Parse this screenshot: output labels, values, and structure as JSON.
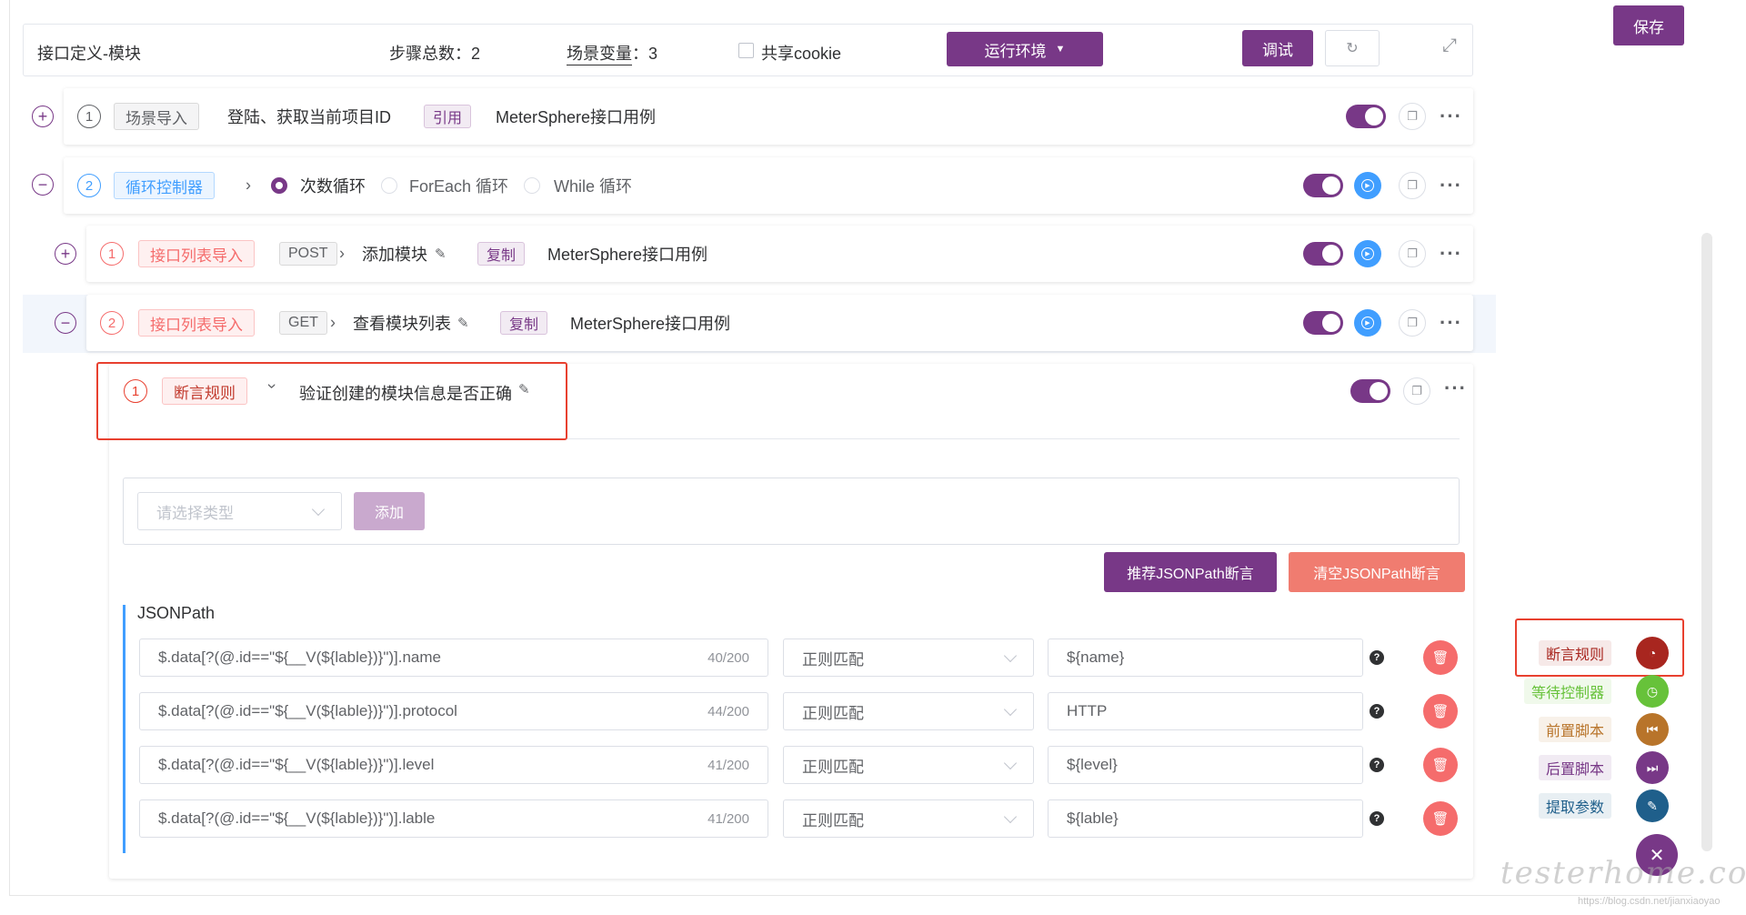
{
  "header": {
    "title": "接口定义-模块",
    "steps_total_label": "步骤总数：2",
    "scene_var_label": "场景变量",
    "scene_var_value": "：3",
    "share_cookie_label": "共享cookie",
    "env_button": "运行环境",
    "debug_button": "调试",
    "save_button": "保存"
  },
  "steps": [
    {
      "num": "1",
      "tag": "场景导入",
      "name": "登陆、获取当前项目ID",
      "ref_tag": "引用",
      "project": "MeterSphere接口用例"
    },
    {
      "num": "2",
      "tag": "循环控制器",
      "loop_options": [
        "次数循环",
        "ForEach 循环",
        "While 循环"
      ]
    },
    {
      "num": "1",
      "tag": "接口列表导入",
      "method": "POST",
      "name": "添加模块",
      "ref_tag": "复制",
      "project": "MeterSphere接口用例"
    },
    {
      "num": "2",
      "tag": "接口列表导入",
      "method": "GET",
      "name": "查看模块列表",
      "ref_tag": "复制",
      "project": "MeterSphere接口用例"
    }
  ],
  "assertion": {
    "num": "1",
    "tag": "断言规则",
    "name": "验证创建的模块信息是否正确",
    "type_placeholder": "请选择类型",
    "add_button": "添加",
    "recommend_button": "推荐JSONPath断言",
    "clear_button": "清空JSONPath断言",
    "section_title": "JSONPath",
    "rows": [
      {
        "expression": "$.data[?(@.id==\"${__V(${lable})}\")].name",
        "count": "40/200",
        "match": "正则匹配",
        "expected": "${name}"
      },
      {
        "expression": "$.data[?(@.id==\"${__V(${lable})}\")].protocol",
        "count": "44/200",
        "match": "正则匹配",
        "expected": "HTTP"
      },
      {
        "expression": "$.data[?(@.id==\"${__V(${lable})}\")].level",
        "count": "41/200",
        "match": "正则匹配",
        "expected": "${level}"
      },
      {
        "expression": "$.data[?(@.id==\"${__V(${lable})}\")].lable",
        "count": "41/200",
        "match": "正则匹配",
        "expected": "${lable}"
      }
    ]
  },
  "side_menu": [
    {
      "label": "断言规则",
      "color": "#a8261f"
    },
    {
      "label": "等待控制器",
      "color": "#67c23a"
    },
    {
      "label": "前置脚本",
      "color": "#b8742a"
    },
    {
      "label": "后置脚本",
      "color": "#783887"
    },
    {
      "label": "提取参数",
      "color": "#1f5f8b"
    }
  ],
  "watermark": "testerhome.com",
  "watermark_sub": "https://blog.csdn.net/jianxiaoyao",
  "colors": {
    "primary": "#783887",
    "danger": "#f56c6c",
    "info": "#409eff",
    "highlight": "#e8402f"
  }
}
